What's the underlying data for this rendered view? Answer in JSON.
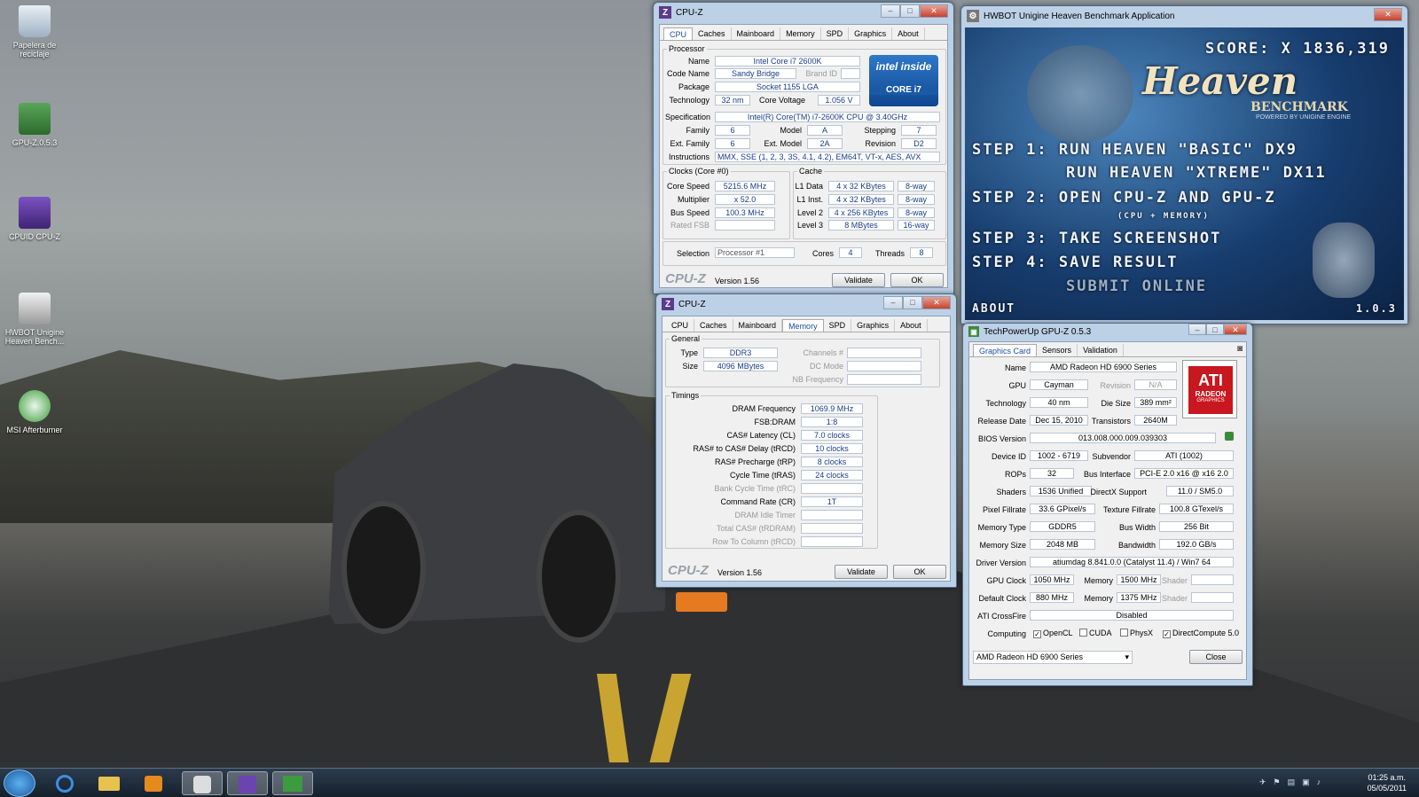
{
  "desktop_icons": [
    {
      "label": "Papelera de reciclaje",
      "icon": "recycle-bin-icon"
    },
    {
      "label": "GPU-Z.0.5.3",
      "icon": "gpu-z-icon"
    },
    {
      "label": "CPUID CPU-Z",
      "icon": "cpu-z-icon"
    },
    {
      "label": "HWBOT Unigine Heaven Bench...",
      "icon": "hwbot-heaven-icon"
    },
    {
      "label": "MSI Afterburner",
      "icon": "msi-afterburner-icon"
    }
  ],
  "cpuz1": {
    "title": "CPU-Z",
    "tabs": [
      "CPU",
      "Caches",
      "Mainboard",
      "Memory",
      "SPD",
      "Graphics",
      "About"
    ],
    "active_tab": "CPU",
    "processor_legend": "Processor",
    "labels": {
      "name": "Name",
      "code_name": "Code Name",
      "brand_id": "Brand ID",
      "package": "Package",
      "technology": "Technology",
      "core_voltage": "Core Voltage",
      "specification": "Specification",
      "family": "Family",
      "model": "Model",
      "stepping": "Stepping",
      "ext_family": "Ext. Family",
      "ext_model": "Ext. Model",
      "revision": "Revision",
      "instructions": "Instructions"
    },
    "values": {
      "name": "Intel Core i7 2600K",
      "code_name": "Sandy Bridge",
      "package": "Socket 1155 LGA",
      "technology": "32 nm",
      "core_voltage": "1.056 V",
      "specification": "Intel(R) Core(TM) i7-2600K CPU @ 3.40GHz",
      "family": "6",
      "model": "A",
      "stepping": "7",
      "ext_family": "6",
      "ext_model": "2A",
      "revision": "D2",
      "instructions": "MMX, SSE (1, 2, 3, 3S, 4.1, 4.2), EM64T, VT-x, AES, AVX"
    },
    "logo_top": "intel inside",
    "logo_bottom": "CORE i7",
    "clocks_legend": "Clocks (Core #0)",
    "clock_labels": [
      "Core Speed",
      "Multiplier",
      "Bus Speed",
      "Rated FSB"
    ],
    "clock_values": [
      "5215.6 MHz",
      "x 52.0",
      "100.3 MHz",
      ""
    ],
    "cache_legend": "Cache",
    "cache_labels": [
      "L1 Data",
      "L1 Inst.",
      "Level 2",
      "Level 3"
    ],
    "cache_values": [
      "4 x 32 KBytes",
      "4 x 32 KBytes",
      "4 x 256 KBytes",
      "8 MBytes"
    ],
    "cache_ways": [
      "8-way",
      "8-way",
      "8-way",
      "16-way"
    ],
    "selection_label": "Selection",
    "selection_value": "Processor #1",
    "cores_label": "Cores",
    "cores_value": "4",
    "threads_label": "Threads",
    "threads_value": "8",
    "brand": "CPU-Z",
    "version": "Version 1.56",
    "validate": "Validate",
    "ok": "OK"
  },
  "cpuz2": {
    "title": "CPU-Z",
    "tabs": [
      "CPU",
      "Caches",
      "Mainboard",
      "Memory",
      "SPD",
      "Graphics",
      "About"
    ],
    "active_tab": "Memory",
    "general_legend": "General",
    "type_label": "Type",
    "type_value": "DDR3",
    "size_label": "Size",
    "size_value": "4096 MBytes",
    "channels_label": "Channels #",
    "dc_mode_label": "DC Mode",
    "nb_freq_label": "NB Frequency",
    "timings_legend": "Timings",
    "timing_labels": [
      "DRAM Frequency",
      "FSB:DRAM",
      "CAS# Latency (CL)",
      "RAS# to CAS# Delay (tRCD)",
      "RAS# Precharge (tRP)",
      "Cycle Time (tRAS)",
      "Bank Cycle Time (tRC)",
      "Command Rate (CR)",
      "DRAM Idle Timer",
      "Total CAS# (tRDRAM)",
      "Row To Column (tRCD)"
    ],
    "timing_values": [
      "1069.9 MHz",
      "1:8",
      "7.0 clocks",
      "10 clocks",
      "8 clocks",
      "24 clocks",
      "",
      "1T",
      "",
      "",
      ""
    ],
    "brand": "CPU-Z",
    "version": "Version 1.56",
    "validate": "Validate",
    "ok": "OK"
  },
  "heaven": {
    "title": "HWBOT Unigine Heaven Benchmark Application",
    "score": "SCORE: X 1836,319",
    "logo": "Heaven",
    "logo_sub": "BENCHMARK",
    "powered": "POWERED BY UNIGINE ENGINE",
    "step1a": "STEP 1:  RUN HEAVEN \"BASIC\" DX9",
    "step1b": "RUN HEAVEN \"XTREME\" DX11",
    "step2": "STEP 2: OPEN CPU-Z  AND  GPU-Z",
    "step2_sub": "(CPU + MEMORY)",
    "step3": "STEP 3: TAKE SCREENSHOT",
    "step4": "STEP 4: SAVE RESULT",
    "submit": "SUBMIT ONLINE",
    "about": "ABOUT",
    "version": "1.0.3"
  },
  "gpuz": {
    "title": "TechPowerUp GPU-Z 0.5.3",
    "tabs": [
      "Graphics Card",
      "Sensors",
      "Validation"
    ],
    "active_tab": "Graphics Card",
    "logo": "ATI",
    "logo_sub": "RADEON",
    "logo_sub2": "GRAPHICS",
    "rows": {
      "name_label": "Name",
      "name": "AMD Radeon HD 6900 Series",
      "gpu_label": "GPU",
      "gpu": "Cayman",
      "revision_label": "Revision",
      "revision": "N/A",
      "technology_label": "Technology",
      "technology": "40 nm",
      "die_size_label": "Die Size",
      "die_size": "389 mm²",
      "release_label": "Release Date",
      "release": "Dec 15, 2010",
      "transistors_label": "Transistors",
      "transistors": "2640M",
      "bios_label": "BIOS Version",
      "bios": "013.008.000.009.039303",
      "device_label": "Device ID",
      "device": "1002 - 6719",
      "subvendor_label": "Subvendor",
      "subvendor": "ATI (1002)",
      "rops_label": "ROPs",
      "rops": "32",
      "bus_label": "Bus Interface",
      "bus": "PCI-E 2.0 x16 @ x16 2.0",
      "shaders_label": "Shaders",
      "shaders": "1536 Unified",
      "dx_label": "DirectX Support",
      "dx": "11.0 / SM5.0",
      "pixel_label": "Pixel Fillrate",
      "pixel": "33.6 GPixel/s",
      "texture_label": "Texture Fillrate",
      "texture": "100.8 GTexel/s",
      "memtype_label": "Memory Type",
      "memtype": "GDDR5",
      "buswidth_label": "Bus Width",
      "buswidth": "256 Bit",
      "memsize_label": "Memory Size",
      "memsize": "2048 MB",
      "bandwidth_label": "Bandwidth",
      "bandwidth": "192.0 GB/s",
      "driver_label": "Driver Version",
      "driver": "atiumdag 8.841.0.0 (Catalyst 11.4) / Win7 64",
      "gpuclock_label": "GPU Clock",
      "gpuclock": "1050 MHz",
      "memory_label": "Memory",
      "gpuclock_mem": "1500 MHz",
      "shader_label": "Shader",
      "defclock_label": "Default Clock",
      "defclock": "880 MHz",
      "defclock_mem": "1375 MHz",
      "crossfire_label": "ATI CrossFire",
      "crossfire": "Disabled",
      "computing_label": "Computing",
      "opencl": "OpenCL",
      "cuda": "CUDA",
      "physx": "PhysX",
      "dc": "DirectCompute 5.0"
    },
    "selected_card": "AMD Radeon HD 6900 Series",
    "close": "Close"
  },
  "taskbar": {
    "time": "01:25 a.m.",
    "date": "05/05/2011"
  },
  "colors": {
    "accent": "#1a3c8a",
    "titlebar": "#bcd0e6",
    "heaven_bg": "#173d6e"
  }
}
